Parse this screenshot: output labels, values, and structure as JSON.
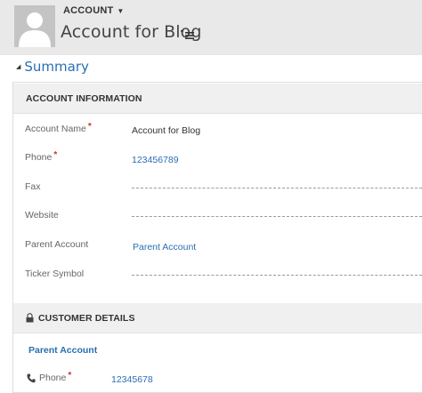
{
  "header": {
    "entity_type": "ACCOUNT",
    "title": "Account for Blog"
  },
  "summary": {
    "label": "Summary"
  },
  "account_information": {
    "title": "ACCOUNT INFORMATION",
    "fields": {
      "account_name": {
        "label": "Account Name",
        "value": "Account for Blog",
        "required": "*"
      },
      "phone": {
        "label": "Phone",
        "value": "123456789",
        "required": "*"
      },
      "fax": {
        "label": "Fax",
        "value": ""
      },
      "website": {
        "label": "Website",
        "value": ""
      },
      "parent_account": {
        "label": "Parent Account",
        "value": "Parent Account"
      },
      "ticker_symbol": {
        "label": "Ticker Symbol",
        "value": ""
      }
    }
  },
  "customer_details": {
    "title": "CUSTOMER DETAILS",
    "parent_account_link": "Parent Account",
    "phone": {
      "label": "Phone",
      "value": "12345678",
      "required": "*"
    }
  },
  "colors": {
    "link": "#2a6fb2",
    "required": "#c0392b",
    "header_bg": "#e9e9e9",
    "section_bg": "#f0f0f0"
  }
}
